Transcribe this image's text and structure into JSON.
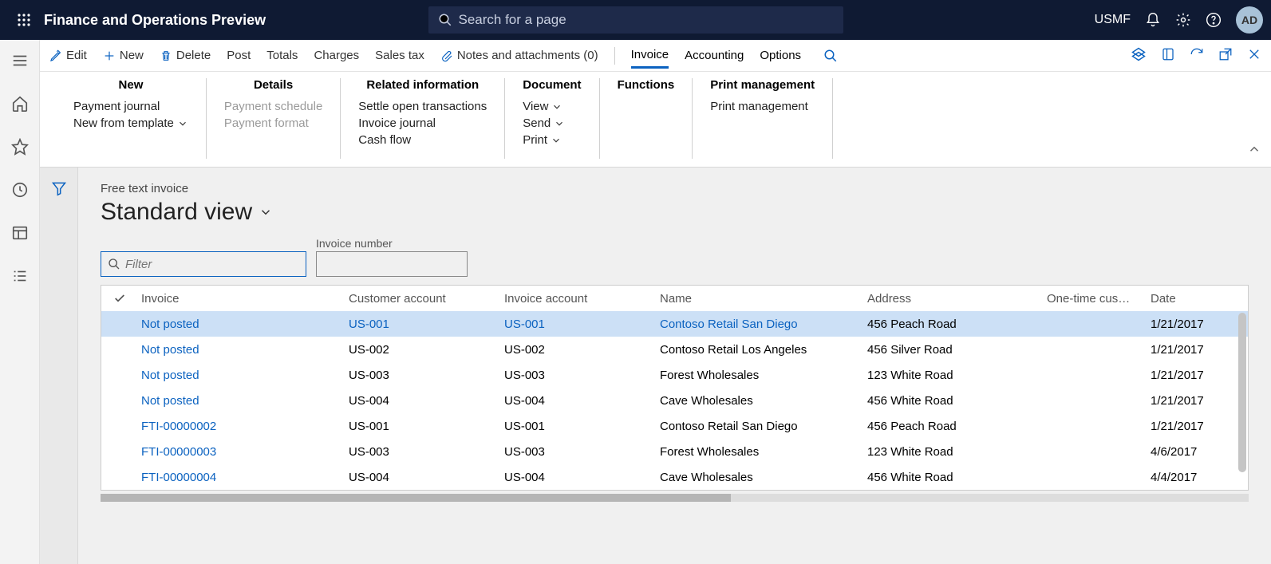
{
  "header": {
    "app_title": "Finance and Operations Preview",
    "search_placeholder": "Search for a page",
    "company": "USMF",
    "avatar": "AD"
  },
  "action_bar": {
    "edit": "Edit",
    "new": "New",
    "delete": "Delete",
    "post": "Post",
    "totals": "Totals",
    "charges": "Charges",
    "sales_tax": "Sales tax",
    "notes": "Notes and attachments (0)",
    "tabs": {
      "invoice": "Invoice",
      "accounting": "Accounting",
      "options": "Options"
    }
  },
  "ribbon": {
    "new": {
      "title": "New",
      "payment_journal": "Payment journal",
      "new_from_template": "New from template"
    },
    "details": {
      "title": "Details",
      "payment_schedule": "Payment schedule",
      "payment_format": "Payment format"
    },
    "related": {
      "title": "Related information",
      "settle": "Settle open transactions",
      "invoice_journal": "Invoice journal",
      "cash_flow": "Cash flow"
    },
    "document": {
      "title": "Document",
      "view": "View",
      "send": "Send",
      "print": "Print"
    },
    "functions": {
      "title": "Functions"
    },
    "print_mgmt": {
      "title": "Print management",
      "print_management": "Print management"
    }
  },
  "content": {
    "breadcrumb": "Free text invoice",
    "view_name": "Standard view",
    "filter_placeholder": "Filter",
    "invoice_number_label": "Invoice number"
  },
  "grid": {
    "columns": {
      "invoice": "Invoice",
      "customer_account": "Customer account",
      "invoice_account": "Invoice account",
      "name": "Name",
      "address": "Address",
      "one_time": "One-time cus…",
      "date": "Date"
    },
    "rows": [
      {
        "invoice": "Not posted",
        "customer": "US-001",
        "invoice_acct": "US-001",
        "name": "Contoso Retail San Diego",
        "address": "456 Peach Road",
        "date": "1/21/2017",
        "selected": true,
        "all_link": true
      },
      {
        "invoice": "Not posted",
        "customer": "US-002",
        "invoice_acct": "US-002",
        "name": "Contoso Retail Los Angeles",
        "address": "456 Silver Road",
        "date": "1/21/2017"
      },
      {
        "invoice": "Not posted",
        "customer": "US-003",
        "invoice_acct": "US-003",
        "name": "Forest Wholesales",
        "address": "123 White Road",
        "date": "1/21/2017"
      },
      {
        "invoice": "Not posted",
        "customer": "US-004",
        "invoice_acct": "US-004",
        "name": "Cave Wholesales",
        "address": "456 White Road",
        "date": "1/21/2017"
      },
      {
        "invoice": "FTI-00000002",
        "customer": "US-001",
        "invoice_acct": "US-001",
        "name": "Contoso Retail San Diego",
        "address": "456 Peach Road",
        "date": "1/21/2017"
      },
      {
        "invoice": "FTI-00000003",
        "customer": "US-003",
        "invoice_acct": "US-003",
        "name": "Forest Wholesales",
        "address": "123 White Road",
        "date": "4/6/2017"
      },
      {
        "invoice": "FTI-00000004",
        "customer": "US-004",
        "invoice_acct": "US-004",
        "name": "Cave Wholesales",
        "address": "456 White Road",
        "date": "4/4/2017"
      }
    ]
  }
}
